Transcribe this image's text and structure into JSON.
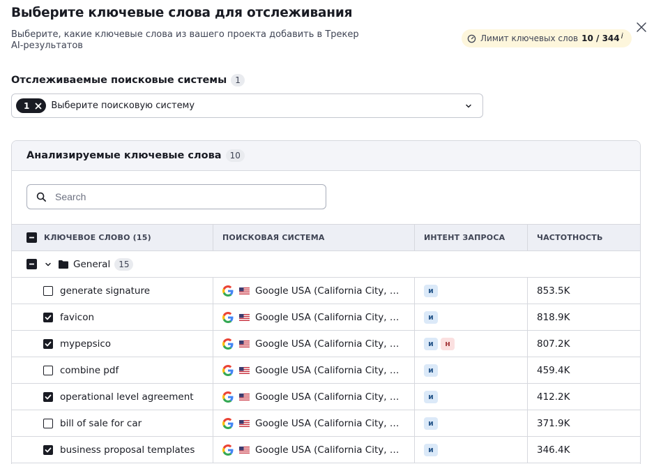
{
  "dialog": {
    "title": "Выберите ключевые слова для отслеживания",
    "subtitle": "Выберите, какие ключевые слова из вашего проекта добавить в Трекер AI-результатов",
    "limit_label": "Лимит ключевых слов",
    "limit_value": "10 / 344",
    "limit_info": "i"
  },
  "search_engines": {
    "label": "Отслеживаемые поисковые системы",
    "count": "1",
    "chip_count": "1",
    "placeholder": "Выберите поисковую систему"
  },
  "keywords_panel": {
    "title": "Анализируемые ключевые слова",
    "count": "10",
    "search_placeholder": "Search"
  },
  "table": {
    "headers": [
      "КЛЮЧЕВОЕ СЛОВО (15)",
      "ПОИСКОВАЯ СИСТЕМА",
      "ИНТЕНТ ЗАПРОСА",
      "ЧАСТОТНОСТЬ"
    ],
    "group": {
      "name": "General",
      "count": "15"
    },
    "rows": [
      {
        "keyword": "generate signature",
        "checked": false,
        "engine": "Google USA (California City, California, United States)",
        "intents": [
          "и"
        ],
        "volume": "853.5K"
      },
      {
        "keyword": "favicon",
        "checked": true,
        "engine": "Google USA (California City, California, United States)",
        "intents": [
          "и"
        ],
        "volume": "818.9K"
      },
      {
        "keyword": "mypepsico",
        "checked": true,
        "engine": "Google USA (California City, California, United States)",
        "intents": [
          "и",
          "н"
        ],
        "volume": "807.2K"
      },
      {
        "keyword": "combine pdf",
        "checked": false,
        "engine": "Google USA (California City, California, United States)",
        "intents": [
          "и"
        ],
        "volume": "459.4K"
      },
      {
        "keyword": "operational level agreement",
        "checked": true,
        "engine": "Google USA (California City, California, United States)",
        "intents": [
          "и"
        ],
        "volume": "412.2K"
      },
      {
        "keyword": "bill of sale for car",
        "checked": false,
        "engine": "Google USA (California City, California, United States)",
        "intents": [
          "и"
        ],
        "volume": "371.9K"
      },
      {
        "keyword": "business proposal templates",
        "checked": true,
        "engine": "Google USA (California City, California, United States)",
        "intents": [
          "и"
        ],
        "volume": "346.4K"
      }
    ]
  },
  "colors": {
    "accent_dark": "#191b23",
    "limit_bg": "#fdf6dc",
    "intent_i_bg": "#dbe9f8",
    "intent_n_bg": "#fbe0e0"
  }
}
